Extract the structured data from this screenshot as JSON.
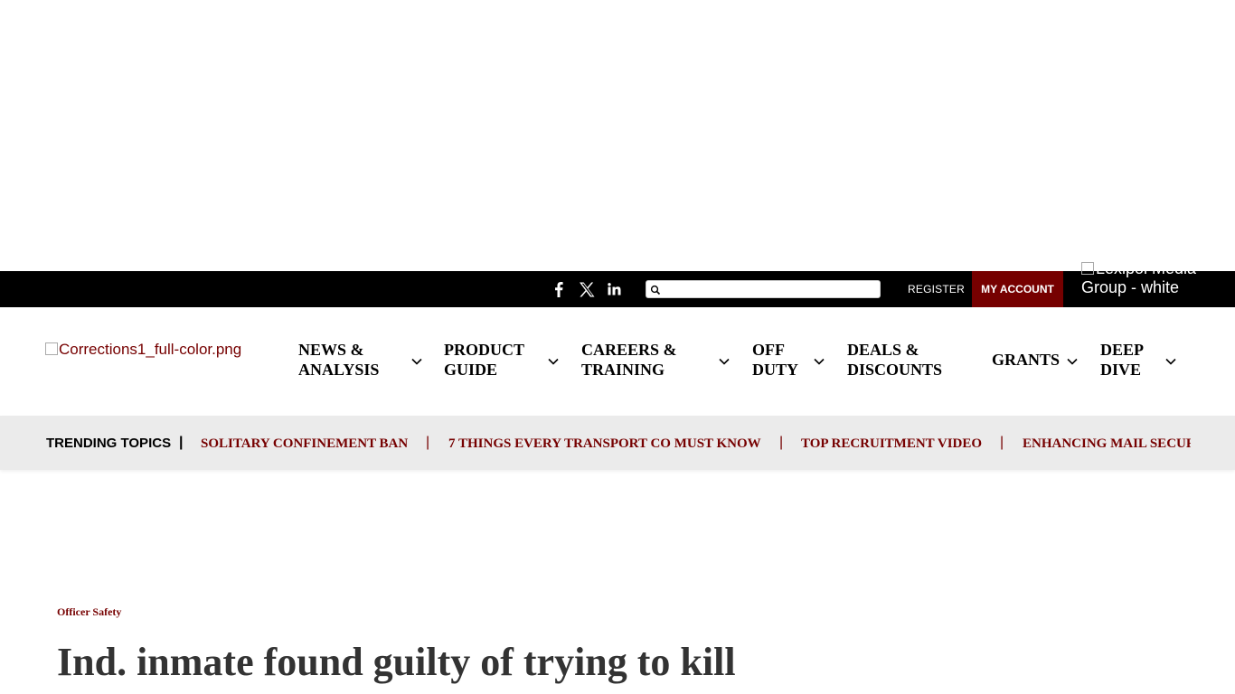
{
  "topbar": {
    "social": [
      {
        "name": "facebook-icon"
      },
      {
        "name": "x-twitter-icon"
      },
      {
        "name": "linkedin-icon"
      }
    ],
    "search": {
      "value": "",
      "placeholder": ""
    },
    "register_label": "REGISTER",
    "my_account_label": "MY ACCOUNT",
    "partner_logo_alt": "Lexipol Media Group - white"
  },
  "nav": {
    "logo_alt": "Corrections1_full-color.png",
    "items": [
      {
        "line1": "NEWS &",
        "line2": "ANALYSIS"
      },
      {
        "line1": "PRODUCT",
        "line2": "GUIDE"
      },
      {
        "line1": "CAREERS &",
        "line2": "TRAINING"
      },
      {
        "line1": "OFF",
        "line2": "DUTY"
      },
      {
        "line1": "DEALS &",
        "line2": "DISCOUNTS"
      },
      {
        "line1": "GRANTS",
        "line2": ""
      },
      {
        "line1": "DEEP",
        "line2": "DIVE"
      }
    ]
  },
  "trending": {
    "label": "TRENDING TOPICS",
    "separator": "|",
    "links": [
      "SOLITARY CONFINEMENT BAN",
      "7 THINGS EVERY TRANSPORT CO MUST KNOW",
      "TOP RECRUITMENT VIDEO",
      "ENHANCING MAIL SECURITY"
    ]
  },
  "article": {
    "category": "Officer Safety",
    "headline": "Ind. inmate found guilty of trying to kill"
  },
  "colors": {
    "brand": "#760000",
    "topbar_bg": "#000000",
    "trending_bg": "#ebebeb",
    "headline": "#333333"
  }
}
